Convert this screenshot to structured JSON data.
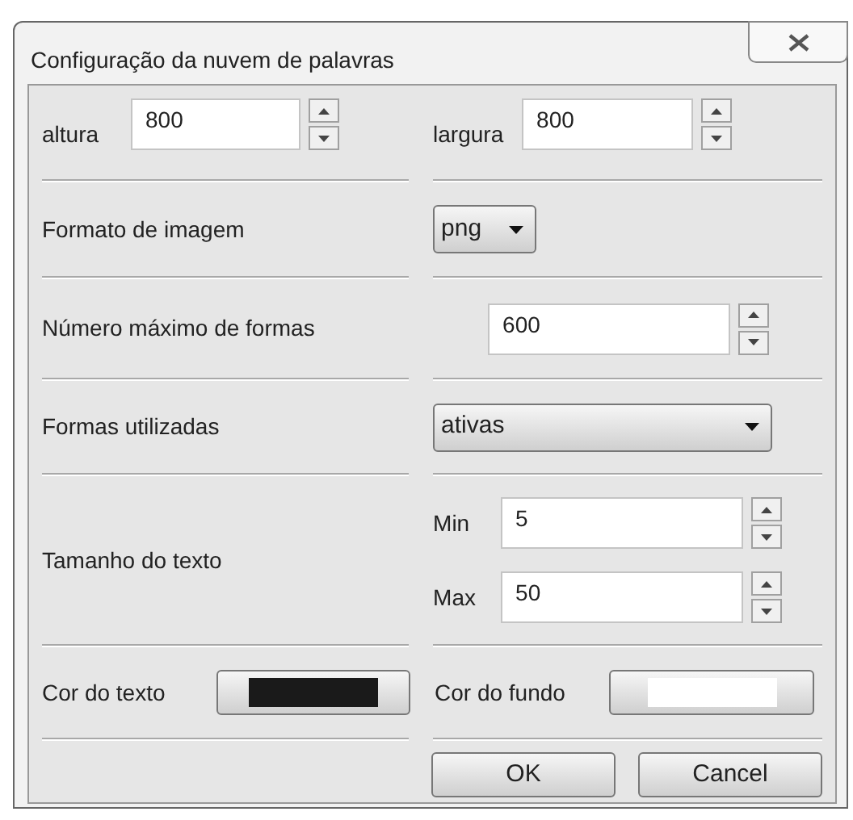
{
  "window": {
    "title": "Configuração da nuvem de palavras"
  },
  "size": [
    {
      "label": "altura",
      "value": "800"
    },
    {
      "label": "largura",
      "value": "800"
    }
  ],
  "image_format": {
    "label": "Formato de imagem",
    "value": "png"
  },
  "max_shapes": {
    "label": "Número máximo de formas",
    "value": "600"
  },
  "shapes_used": {
    "label": "Formas utilizadas",
    "value": "ativas"
  },
  "text_size": {
    "label": "Tamanho do texto",
    "fields": [
      {
        "label": "Min",
        "value": "5"
      },
      {
        "label": "Max",
        "value": "50"
      }
    ]
  },
  "colors": [
    {
      "label": "Cor do texto",
      "color": "#1a1a1a"
    },
    {
      "label": "Cor do fundo",
      "color": "#ffffff"
    }
  ],
  "buttons": [
    "OK",
    "Cancel"
  ]
}
